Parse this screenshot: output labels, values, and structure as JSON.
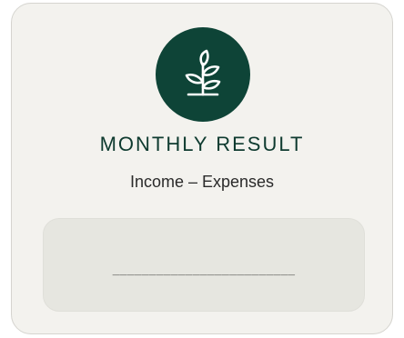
{
  "card": {
    "icon": "sprout-icon",
    "title": "MONTHLY RESULT",
    "subtitle": "Income – Expenses",
    "result_placeholder": "_________________________"
  },
  "colors": {
    "icon_circle": "#0e4437",
    "title": "#0e3a2f",
    "card_background": "#f3f2ee",
    "result_box": "#e6e6e0"
  }
}
